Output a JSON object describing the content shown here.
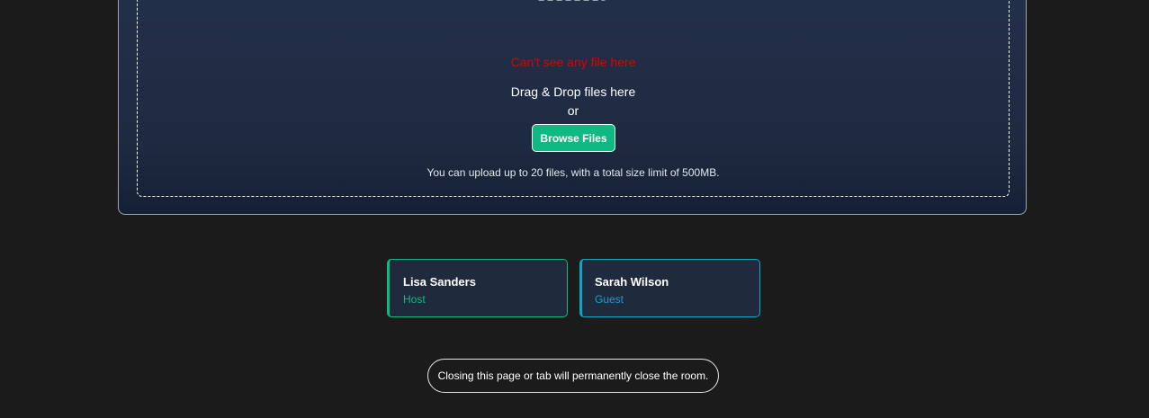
{
  "upload": {
    "empty_message": "Can't see any file here",
    "drag_text": "Drag & Drop files here",
    "or_text": "or",
    "browse_label": "Browse Files",
    "limit_text": "You can upload up to 20 files, with a total size limit of 500MB.",
    "illustration_icon": "folder-dashed-icon"
  },
  "participants": [
    {
      "name": "Lisa Sanders",
      "role": "Host",
      "color": "#10b981"
    },
    {
      "name": "Sarah Wilson",
      "role": "Guest",
      "color": "#0ea5c9"
    }
  ],
  "footer": {
    "warning": "Closing this page or tab will permanently close the room."
  },
  "colors": {
    "background": "#1b1b1c",
    "panel": "#1e2a40",
    "accent": "#10b981",
    "error": "#e00000"
  }
}
